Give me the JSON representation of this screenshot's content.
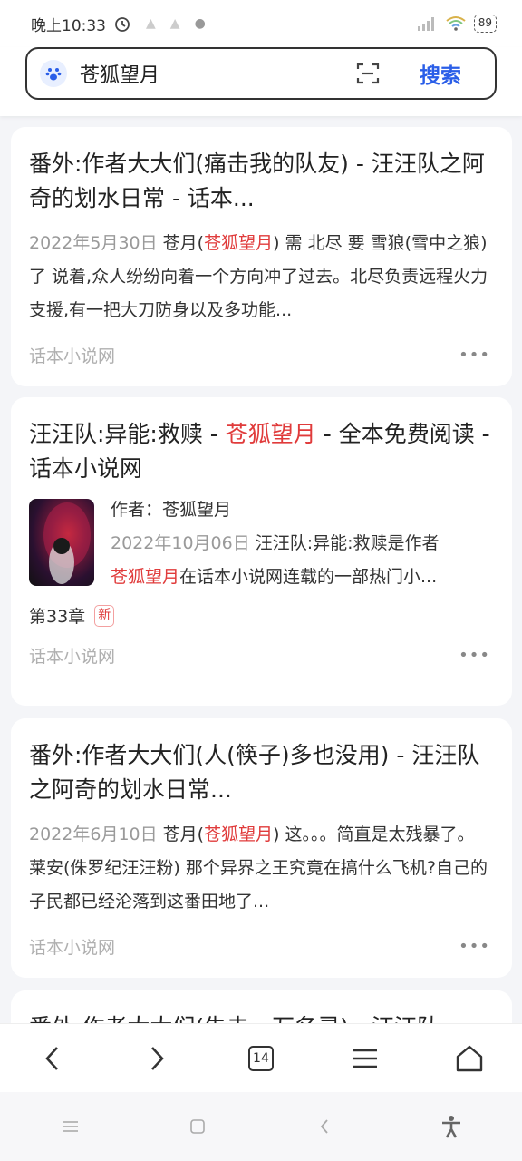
{
  "status": {
    "time": "晚上10:33",
    "battery": "89"
  },
  "search": {
    "query": "苍狐望月",
    "button_label": "搜索"
  },
  "results": [
    {
      "title_parts": [
        "番外:作者大大们(痛击我的队友) - 汪汪队之阿奇的划水日常 - 话本..."
      ],
      "date": "2022年5月30日",
      "snippet_pre": " 苍月(",
      "snippet_hl": "苍狐望月",
      "snippet_post": ") 需 北尽 要 雪狼(雪中之狼) 了 说着,众人纷纷向着一个方向冲了过去。北尽负责远程火力支援,有一把大刀防身以及多功能...",
      "source": "话本小说网"
    },
    {
      "title_pre": "汪汪队:异能:救赎 - ",
      "title_hl": "苍狐望月",
      "title_post": " - 全本免费阅读 - 话本小说网",
      "author_label": "作者：苍狐望月",
      "date": "2022年10月06日",
      "snippet_pre": " 汪汪队:异能:救赎是作者",
      "snippet_hl": "苍狐望月",
      "snippet_post": "在话本小说网连载的一部热门小...",
      "chapter": "第33章",
      "badge": "新",
      "source": "话本小说网"
    },
    {
      "title_parts": [
        "番外:作者大大们(人(筷子)多也没用) - 汪汪队之阿奇的划水日常..."
      ],
      "date": "2022年6月10日",
      "snippet_pre": " 苍月(",
      "snippet_hl": "苍狐望月",
      "snippet_post": ") 这。。。简直是太残暴了。 莱安(侏罗纪汪汪粉) 那个异界之王究竟在搞什么飞机?自己的子民都已经沦落到这番田地了...",
      "source": "话本小说网"
    },
    {
      "title_partial": "番外:作者大大们(失去一万名灵) - 汪汪队"
    }
  ],
  "browser": {
    "tab_count": "14"
  },
  "colors": {
    "accent": "#2a5ee8",
    "highlight": "#e03b3b"
  },
  "icons": [
    "alarm-icon",
    "wifi-icon",
    "signal-icon",
    "paw-icon",
    "scan-icon",
    "back-icon",
    "forward-icon",
    "menu-icon",
    "home-icon",
    "accessibility-icon"
  ]
}
